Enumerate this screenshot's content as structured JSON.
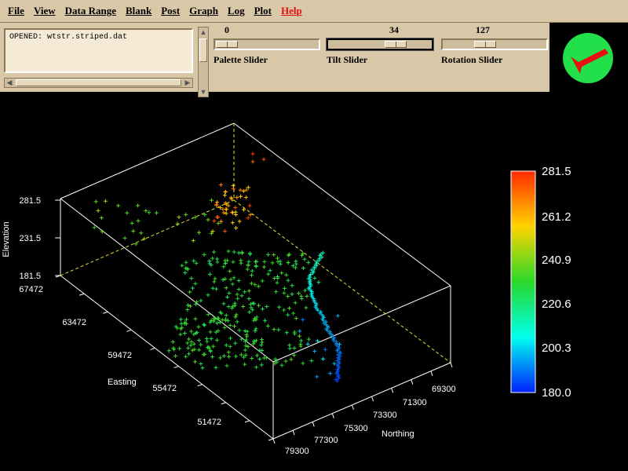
{
  "menu": [
    "File",
    "View",
    "Data Range",
    "Blank",
    "Post",
    "Graph",
    "Log",
    "Plot",
    "Help"
  ],
  "log": {
    "text": "OPENED: wtstr.striped.dat"
  },
  "sliders": [
    {
      "label": "Palette Slider",
      "value": "0"
    },
    {
      "label": "Tilt Slider",
      "value": "34"
    },
    {
      "label": "Rotation Slider",
      "value": "127"
    }
  ],
  "compass_icon": "red-arrow-in-green-circle",
  "colorbar": {
    "labels": [
      "281.5",
      "261.2",
      "240.9",
      "220.6",
      "200.3",
      "180.0"
    ],
    "colors": [
      "#ff2a00",
      "#ffd400",
      "#2ad82a",
      "#00ffee",
      "#0020ff"
    ]
  },
  "axes": {
    "elevation_label": "Elevation",
    "elevation_ticks": [
      "281.5",
      "231.5",
      "181.5"
    ],
    "easting_label": "Easting",
    "easting_ticks": [
      "67472",
      "63472",
      "59472",
      "55472",
      "51472"
    ],
    "northing_label": "Northing",
    "northing_ticks": [
      "69300",
      "71300",
      "73300",
      "75300",
      "77300",
      "79300"
    ]
  },
  "chart_data": {
    "type": "scatter",
    "xlabel": "Easting",
    "ylabel": "Northing",
    "zlabel": "Elevation",
    "xlim": [
      51472,
      67472
    ],
    "ylim": [
      69300,
      79300
    ],
    "zlim": [
      181.5,
      281.5
    ],
    "colorbar_range": [
      180.0,
      281.5
    ]
  }
}
